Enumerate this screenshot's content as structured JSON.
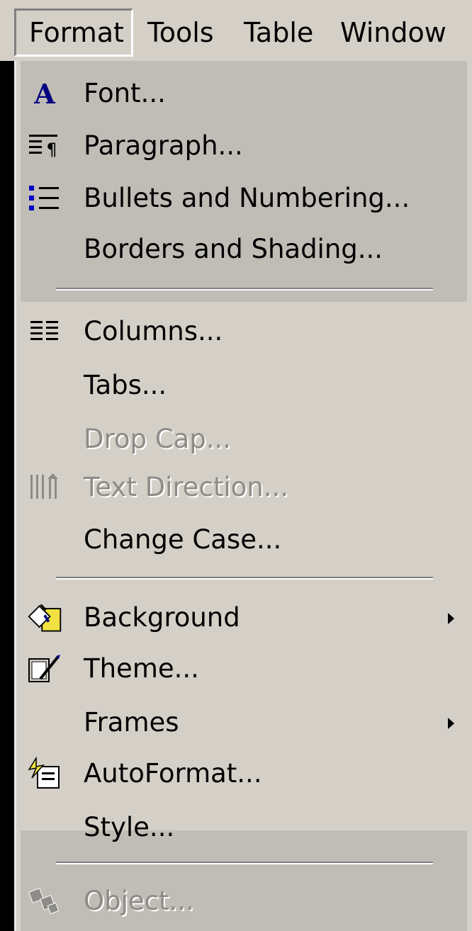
{
  "menubar": {
    "items": [
      {
        "label": "Format",
        "state": "open"
      },
      {
        "label": "Tools"
      },
      {
        "label": "Table"
      },
      {
        "label": "Window"
      }
    ]
  },
  "format_menu": {
    "items": [
      {
        "label": "Font...",
        "icon": "font-A-icon",
        "enabled": true
      },
      {
        "label": "Paragraph...",
        "icon": "paragraph-icon",
        "enabled": true
      },
      {
        "label": "Bullets and Numbering...",
        "icon": "bullets-icon",
        "enabled": true
      },
      {
        "label": "Borders and Shading...",
        "icon": null,
        "enabled": true
      },
      {
        "label": "Columns...",
        "icon": "columns-icon",
        "enabled": true
      },
      {
        "label": "Tabs...",
        "icon": null,
        "enabled": true
      },
      {
        "label": "Drop Cap...",
        "icon": null,
        "enabled": false
      },
      {
        "label": "Text Direction...",
        "icon": "text-direction-icon",
        "enabled": false
      },
      {
        "label": "Change Case...",
        "icon": null,
        "enabled": true
      },
      {
        "label": "Background",
        "icon": "background-fill-icon",
        "enabled": true,
        "submenu": true
      },
      {
        "label": "Theme...",
        "icon": "theme-icon",
        "enabled": true
      },
      {
        "label": "Frames",
        "icon": null,
        "enabled": true,
        "submenu": true
      },
      {
        "label": "AutoFormat...",
        "icon": "autoformat-icon",
        "enabled": true
      },
      {
        "label": "Style...",
        "icon": null,
        "enabled": true
      },
      {
        "label": "Object...",
        "icon": "object-icon",
        "enabled": false
      }
    ]
  },
  "colors": {
    "menu_face": "#d4d0c8",
    "band": "#c0bdb6",
    "disabled_text": "#8e8c87",
    "icon_blue": "#000080"
  }
}
